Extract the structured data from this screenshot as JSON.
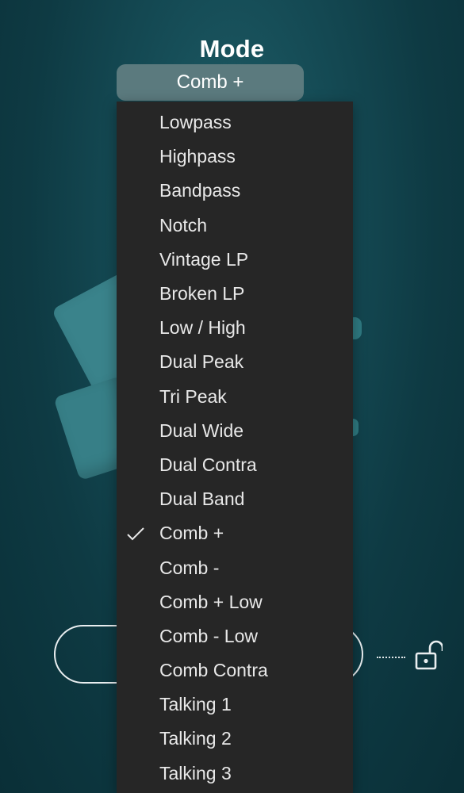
{
  "header": {
    "title": "Mode",
    "selected_value": "Comb +"
  },
  "menu": {
    "selected_index": 12,
    "items": [
      {
        "label": "Lowpass"
      },
      {
        "label": "Highpass"
      },
      {
        "label": "Bandpass"
      },
      {
        "label": "Notch"
      },
      {
        "label": "Vintage LP"
      },
      {
        "label": "Broken LP"
      },
      {
        "label": "Low / High"
      },
      {
        "label": "Dual Peak"
      },
      {
        "label": "Tri Peak"
      },
      {
        "label": "Dual Wide"
      },
      {
        "label": "Dual Contra"
      },
      {
        "label": "Dual Band"
      },
      {
        "label": "Comb +"
      },
      {
        "label": "Comb -"
      },
      {
        "label": "Comb + Low"
      },
      {
        "label": "Comb - Low"
      },
      {
        "label": "Comb Contra"
      },
      {
        "label": "Talking 1"
      },
      {
        "label": "Talking 2"
      },
      {
        "label": "Talking 3"
      }
    ]
  },
  "icons": {
    "selected_marker": "checkmark-icon",
    "lock": "unlocked-padlock-icon"
  },
  "colors": {
    "background": "#154b55",
    "menu_background": "#262626",
    "select_background": "#5b7a7e",
    "menu_text": "#e8e8e8"
  }
}
